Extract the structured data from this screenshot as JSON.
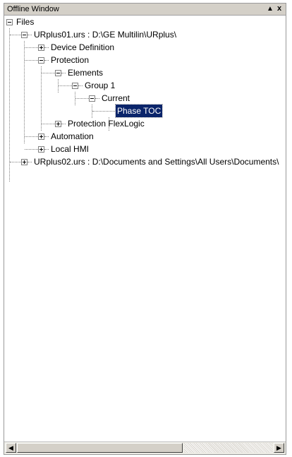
{
  "window": {
    "title": "Offline Window",
    "pin_glyph": "▲",
    "close_glyph": "x"
  },
  "tree": {
    "root": "Files",
    "file1": "URplus01.urs : D:\\GE Multilin\\URplus\\",
    "device_definition": "Device Definition",
    "protection": "Protection",
    "elements": "Elements",
    "group1": "Group 1",
    "current": "Current",
    "phase_toc": "Phase TOC",
    "protection_flexlogic": "Protection FlexLogic",
    "automation": "Automation",
    "local_hmi": "Local HMI",
    "file2": "URplus02.urs : D:\\Documents and Settings\\All Users\\Documents\\"
  },
  "scrollbar": {
    "left_glyph": "◀",
    "right_glyph": "▶"
  },
  "colors": {
    "selection": "#0a246a",
    "titlebar": "#d4d0c8"
  }
}
